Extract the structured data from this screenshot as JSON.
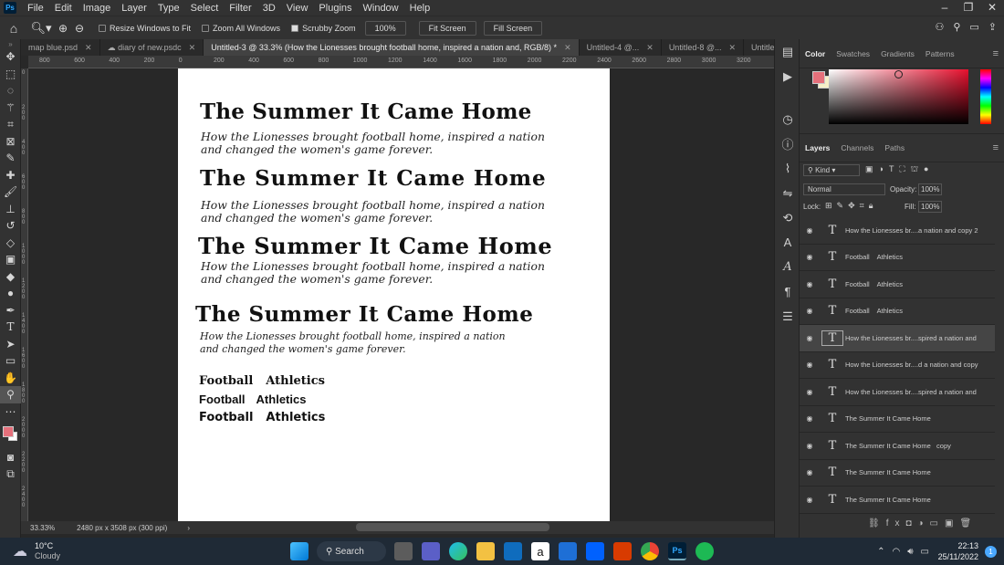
{
  "menu": {
    "items": [
      "File",
      "Edit",
      "Image",
      "Layer",
      "Type",
      "Select",
      "Filter",
      "3D",
      "View",
      "Plugins",
      "Window",
      "Help"
    ],
    "logo": "Ps"
  },
  "options": {
    "resize_windows": "Resize Windows to Fit",
    "zoom_all": "Zoom All Windows",
    "scrubby_zoom": "Scrubby Zoom",
    "zoom_value": "100%",
    "fit_screen": "Fit Screen",
    "fill_screen": "Fill Screen"
  },
  "tabs": [
    {
      "label": "map blue.psd"
    },
    {
      "label": "diary of new.psdc"
    },
    {
      "label": "Untitled-3 @ 33.3% (How the Lionesses brought football home, inspired a nation  and, RGB/8) *"
    },
    {
      "label": "Untitled-4 @..."
    },
    {
      "label": "Untitled-8 @..."
    },
    {
      "label": "Untitled-9 @."
    }
  ],
  "ruler": {
    "h_ticks": [
      "800",
      "600",
      "400",
      "200",
      "0",
      "200",
      "400",
      "600",
      "800",
      "1000",
      "1200",
      "1400",
      "1600",
      "1800",
      "2000",
      "2200",
      "2400",
      "2600",
      "2800",
      "3000",
      "3200"
    ],
    "v_ticks": [
      "0",
      "200",
      "400",
      "600",
      "800",
      "1000",
      "1200",
      "1400",
      "1600",
      "1800",
      "2000",
      "2200",
      "2400"
    ]
  },
  "document": {
    "blocks": [
      {
        "headline": "The Summer It Came Home",
        "sub1": "How the Lionesses brought football home, inspired a nation",
        "sub2": "and changed the women's game forever."
      },
      {
        "headline": "The Summer It Came Home",
        "sub1": "How the Lionesses brought football home, inspired a nation",
        "sub2": "and changed the women's game forever."
      },
      {
        "headline": "The Summer It Came Home",
        "sub1": "How the Lionesses brought football home, inspired a nation",
        "sub2": "and changed the women's game forever."
      },
      {
        "headline": "The Summer It Came Home",
        "sub1": "How the Lionesses brought football home, inspired a nation",
        "sub2": "and changed the women's game forever."
      }
    ],
    "football_rows": [
      {
        "a": "Football",
        "b": "Athletics"
      },
      {
        "a": "Football",
        "b": "Athletics"
      },
      {
        "a": "Football",
        "b": "Athletics"
      }
    ]
  },
  "status": {
    "zoom": "33.33%",
    "doc_size": "2480 px x 3508 px (300 ppi)"
  },
  "color_panel": {
    "tabs": [
      "Color",
      "Swatches",
      "Gradients",
      "Patterns"
    ],
    "fg": "#e5707b",
    "bg": "#f5efc8"
  },
  "layers_panel": {
    "tabs": [
      "Layers",
      "Channels",
      "Paths"
    ],
    "kind": "Kind",
    "blend": "Normal",
    "opacity_label": "Opacity:",
    "opacity": "100%",
    "lock_label": "Lock:",
    "fill_label": "Fill:",
    "fill": "100%",
    "layers": [
      {
        "name": "How the Lionesses br....a nation  and copy 2"
      },
      {
        "name": "Football    Athletics"
      },
      {
        "name": "Football    Athletics"
      },
      {
        "name": "Football    Athletics"
      },
      {
        "name": "How the Lionesses br....spired a nation  and",
        "selected": true
      },
      {
        "name": "How the Lionesses br....d a nation  and copy"
      },
      {
        "name": "How the Lionesses br....spired a nation  and"
      },
      {
        "name": "The Summer It Came Home"
      },
      {
        "name": "The Summer It Came Home   copy"
      },
      {
        "name": "The Summer It Came Home"
      },
      {
        "name": "The Summer It Came Home"
      }
    ]
  },
  "taskbar": {
    "weather_temp": "10°C",
    "weather_desc": "Cloudy",
    "search": "Search",
    "time": "22:13",
    "date": "25/11/2022",
    "notif": "1"
  }
}
